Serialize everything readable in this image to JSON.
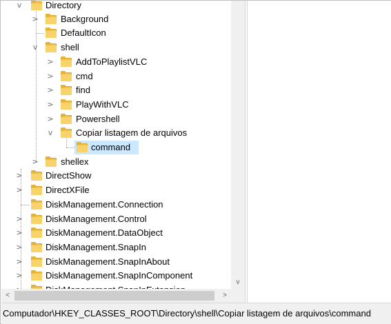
{
  "tree": {
    "nodes": [
      {
        "label": "Directory",
        "toggle": "v"
      },
      {
        "label": "Background",
        "toggle": ">"
      },
      {
        "label": "DefaultIcon",
        "toggle": ""
      },
      {
        "label": "shell",
        "toggle": "v"
      },
      {
        "label": "AddToPlaylistVLC",
        "toggle": ">"
      },
      {
        "label": "cmd",
        "toggle": ">"
      },
      {
        "label": "find",
        "toggle": ">"
      },
      {
        "label": "PlayWithVLC",
        "toggle": ">"
      },
      {
        "label": "Powershell",
        "toggle": ">"
      },
      {
        "label": "Copiar listagem de arquivos",
        "toggle": "v"
      },
      {
        "label": "command",
        "toggle": "",
        "selected": true
      },
      {
        "label": "shellex",
        "toggle": ">"
      },
      {
        "label": "DirectShow",
        "toggle": ">"
      },
      {
        "label": "DirectXFile",
        "toggle": ">"
      },
      {
        "label": "DiskManagement.Connection",
        "toggle": ""
      },
      {
        "label": "DiskManagement.Control",
        "toggle": ">"
      },
      {
        "label": "DiskManagement.DataObject",
        "toggle": ">"
      },
      {
        "label": "DiskManagement.SnapIn",
        "toggle": ">"
      },
      {
        "label": "DiskManagement.SnapInAbout",
        "toggle": ">"
      },
      {
        "label": "DiskManagement.SnapInComponent",
        "toggle": ">"
      },
      {
        "label": "DiskManagement.SnapInExtension",
        "toggle": ">"
      }
    ],
    "scroll_down_glyph": "v",
    "scroll_left_glyph": "<",
    "scroll_right_glyph": ">"
  },
  "statusbar": {
    "path": "Computador\\HKEY_CLASSES_ROOT\\Directory\\shell\\Copiar listagem de arquivos\\command"
  },
  "colors": {
    "folder": "#f0c24a",
    "selection": "#cce8ff"
  }
}
